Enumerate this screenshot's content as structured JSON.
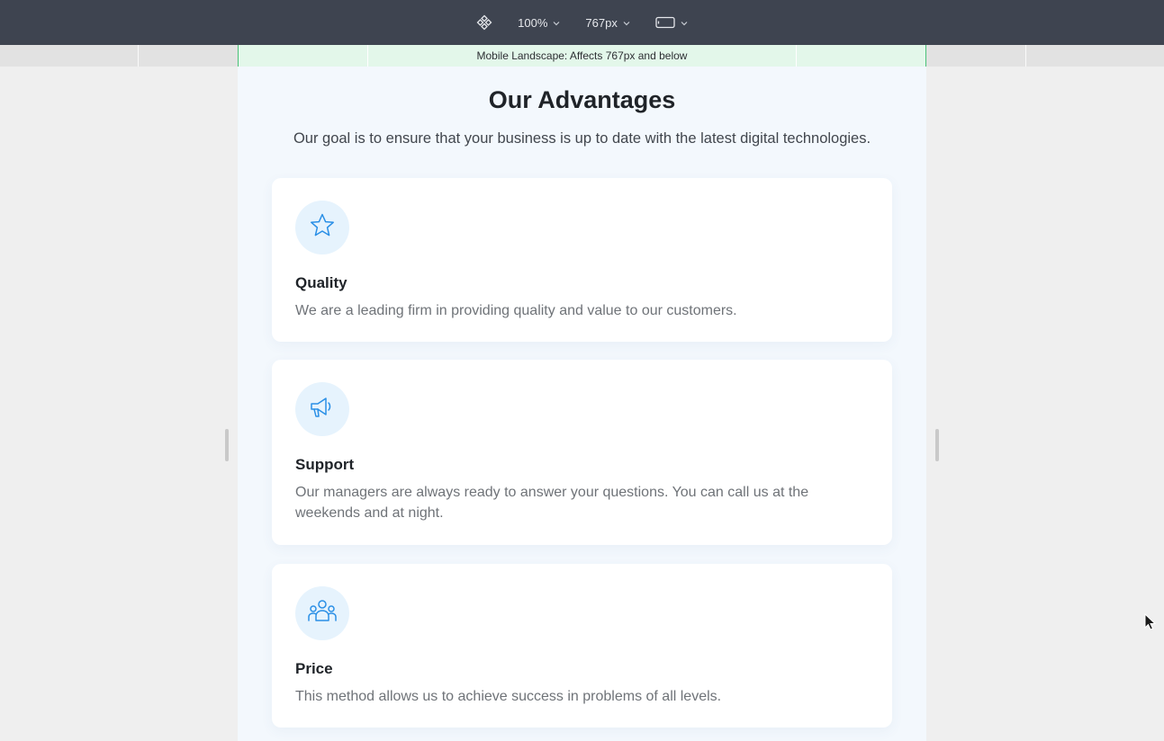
{
  "toolbar": {
    "zoom_label": "100%",
    "width_label": "767px",
    "icons": [
      "responsive-mode-icon",
      "chevron-down-icon",
      "device-landscape-icon"
    ]
  },
  "breakpoint_bar": {
    "label": "Mobile Landscape: Affects 767px and below",
    "active_color": "#e3f7ea",
    "border_color": "#4cc27a"
  },
  "section": {
    "title": "Our Advantages",
    "subtitle": "Our goal is to ensure that your business is up to date with the latest digital technologies."
  },
  "cards": [
    {
      "icon": "star-icon",
      "title": "Quality",
      "text": "We are a leading firm in providing quality and value to our customers."
    },
    {
      "icon": "megaphone-icon",
      "title": "Support",
      "text": "Our managers are always ready to answer your questions. You can call us at the weekends and at night."
    },
    {
      "icon": "users-icon",
      "title": "Price",
      "text": "This method allows us to achieve success in problems of all levels."
    }
  ],
  "colors": {
    "toolbar_bg": "#3e4450",
    "accent_icon": "#2a8fe6",
    "icon_bg": "#e6f3fd",
    "frame_bg": "#f3f8fd"
  }
}
